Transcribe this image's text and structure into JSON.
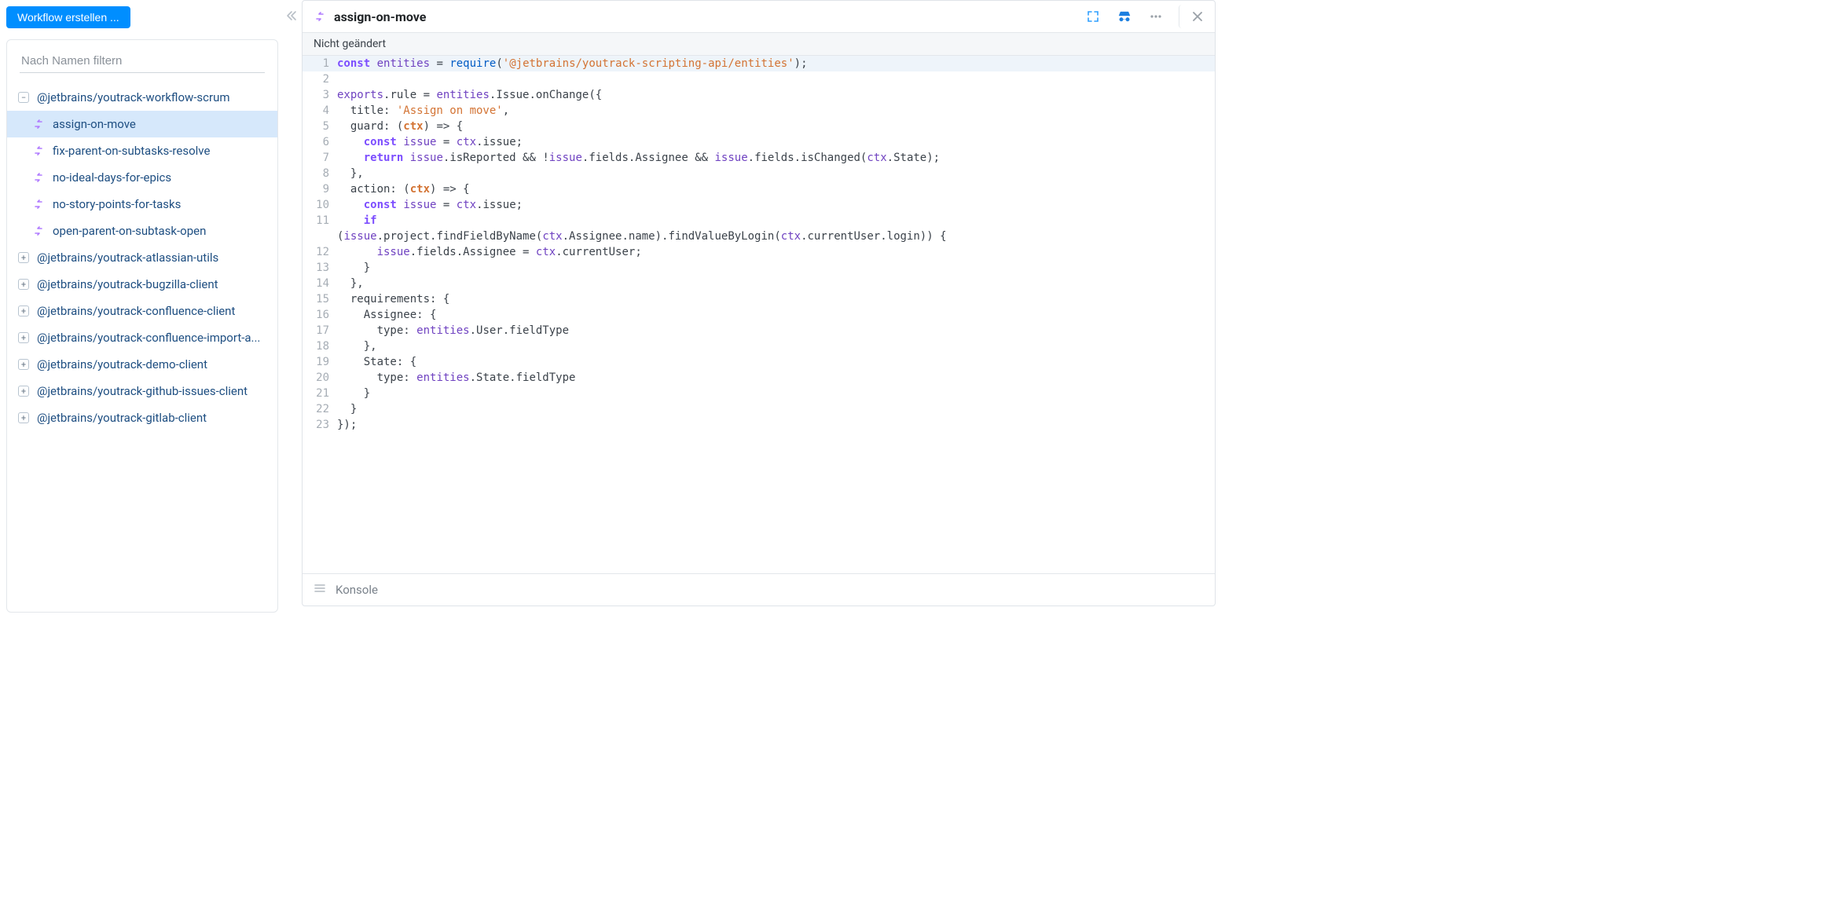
{
  "sidebar": {
    "create_button": "Workflow erstellen ...",
    "filter_placeholder": "Nach Namen filtern",
    "groups": [
      {
        "name": "@jetbrains/youtrack-workflow-scrum",
        "expanded": true,
        "rules": [
          {
            "name": "assign-on-move",
            "selected": true
          },
          {
            "name": "fix-parent-on-subtasks-resolve",
            "selected": false
          },
          {
            "name": "no-ideal-days-for-epics",
            "selected": false
          },
          {
            "name": "no-story-points-for-tasks",
            "selected": false
          },
          {
            "name": "open-parent-on-subtask-open",
            "selected": false
          }
        ]
      },
      {
        "name": "@jetbrains/youtrack-atlassian-utils",
        "expanded": false
      },
      {
        "name": "@jetbrains/youtrack-bugzilla-client",
        "expanded": false
      },
      {
        "name": "@jetbrains/youtrack-confluence-client",
        "expanded": false
      },
      {
        "name": "@jetbrains/youtrack-confluence-import-a...",
        "expanded": false
      },
      {
        "name": "@jetbrains/youtrack-demo-client",
        "expanded": false
      },
      {
        "name": "@jetbrains/youtrack-github-issues-client",
        "expanded": false
      },
      {
        "name": "@jetbrains/youtrack-gitlab-client",
        "expanded": false
      }
    ]
  },
  "editor": {
    "title": "assign-on-move",
    "status": "Nicht geändert",
    "console_label": "Konsole",
    "code_lines": [
      {
        "n": 1,
        "hl": true,
        "tokens": [
          [
            "kw",
            "const"
          ],
          [
            "op",
            " "
          ],
          [
            "var",
            "entities"
          ],
          [
            "op",
            " = "
          ],
          [
            "fn",
            "require"
          ],
          [
            "op",
            "("
          ],
          [
            "str",
            "'@jetbrains/youtrack-scripting-api/entities'"
          ],
          [
            "op",
            ");"
          ]
        ]
      },
      {
        "n": 2,
        "tokens": []
      },
      {
        "n": 3,
        "tokens": [
          [
            "var",
            "exports"
          ],
          [
            "op",
            ".rule = "
          ],
          [
            "var",
            "entities"
          ],
          [
            "op",
            ".Issue.onChange({"
          ]
        ]
      },
      {
        "n": 4,
        "tokens": [
          [
            "op",
            "  title: "
          ],
          [
            "str",
            "'Assign on move'"
          ],
          [
            "op",
            ","
          ]
        ]
      },
      {
        "n": 5,
        "tokens": [
          [
            "op",
            "  guard: ("
          ],
          [
            "arg",
            "ctx"
          ],
          [
            "op",
            ") => {"
          ]
        ]
      },
      {
        "n": 6,
        "tokens": [
          [
            "op",
            "    "
          ],
          [
            "kw",
            "const"
          ],
          [
            "op",
            " "
          ],
          [
            "var",
            "issue"
          ],
          [
            "op",
            " = "
          ],
          [
            "var",
            "ctx"
          ],
          [
            "op",
            ".issue;"
          ]
        ]
      },
      {
        "n": 7,
        "tokens": [
          [
            "op",
            "    "
          ],
          [
            "kw",
            "return"
          ],
          [
            "op",
            " "
          ],
          [
            "var",
            "issue"
          ],
          [
            "op",
            ".isReported && !"
          ],
          [
            "var",
            "issue"
          ],
          [
            "op",
            ".fields.Assignee && "
          ],
          [
            "var",
            "issue"
          ],
          [
            "op",
            ".fields.isChanged("
          ],
          [
            "var",
            "ctx"
          ],
          [
            "op",
            ".State);"
          ]
        ]
      },
      {
        "n": 8,
        "tokens": [
          [
            "op",
            "  },"
          ]
        ]
      },
      {
        "n": 9,
        "tokens": [
          [
            "op",
            "  action: ("
          ],
          [
            "arg",
            "ctx"
          ],
          [
            "op",
            ") => {"
          ]
        ]
      },
      {
        "n": 10,
        "tokens": [
          [
            "op",
            "    "
          ],
          [
            "kw",
            "const"
          ],
          [
            "op",
            " "
          ],
          [
            "var",
            "issue"
          ],
          [
            "op",
            " = "
          ],
          [
            "var",
            "ctx"
          ],
          [
            "op",
            ".issue;"
          ]
        ]
      },
      {
        "n": 11,
        "tokens": [
          [
            "op",
            "    "
          ],
          [
            "kw",
            "if"
          ]
        ]
      },
      {
        "n": 11,
        "continuation": true,
        "tokens": [
          [
            "op",
            "("
          ],
          [
            "var",
            "issue"
          ],
          [
            "op",
            ".project.findFieldByName("
          ],
          [
            "var",
            "ctx"
          ],
          [
            "op",
            ".Assignee.name).findValueByLogin("
          ],
          [
            "var",
            "ctx"
          ],
          [
            "op",
            ".currentUser.login)) {"
          ]
        ]
      },
      {
        "n": 12,
        "tokens": [
          [
            "op",
            "      "
          ],
          [
            "var",
            "issue"
          ],
          [
            "op",
            ".fields.Assignee = "
          ],
          [
            "var",
            "ctx"
          ],
          [
            "op",
            ".currentUser;"
          ]
        ]
      },
      {
        "n": 13,
        "tokens": [
          [
            "op",
            "    }"
          ]
        ]
      },
      {
        "n": 14,
        "tokens": [
          [
            "op",
            "  },"
          ]
        ]
      },
      {
        "n": 15,
        "tokens": [
          [
            "op",
            "  requirements: {"
          ]
        ]
      },
      {
        "n": 16,
        "tokens": [
          [
            "op",
            "    Assignee: {"
          ]
        ]
      },
      {
        "n": 17,
        "tokens": [
          [
            "op",
            "      type: "
          ],
          [
            "var",
            "entities"
          ],
          [
            "op",
            ".User.fieldType"
          ]
        ]
      },
      {
        "n": 18,
        "tokens": [
          [
            "op",
            "    },"
          ]
        ]
      },
      {
        "n": 19,
        "tokens": [
          [
            "op",
            "    State: {"
          ]
        ]
      },
      {
        "n": 20,
        "tokens": [
          [
            "op",
            "      type: "
          ],
          [
            "var",
            "entities"
          ],
          [
            "op",
            ".State.fieldType"
          ]
        ]
      },
      {
        "n": 21,
        "tokens": [
          [
            "op",
            "    }"
          ]
        ]
      },
      {
        "n": 22,
        "tokens": [
          [
            "op",
            "  }"
          ]
        ]
      },
      {
        "n": 23,
        "tokens": [
          [
            "op",
            "});"
          ]
        ]
      }
    ]
  }
}
